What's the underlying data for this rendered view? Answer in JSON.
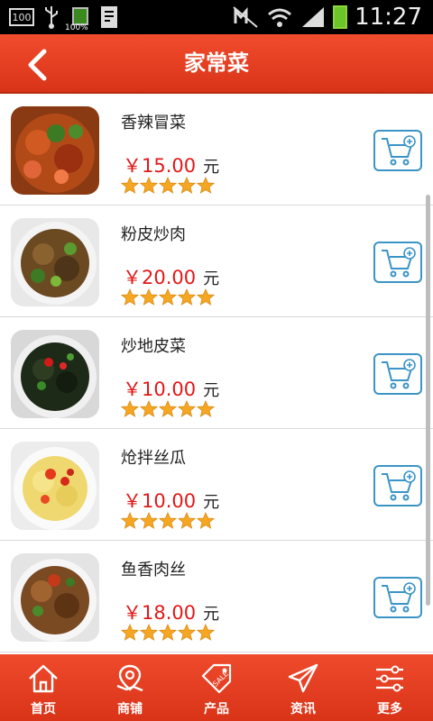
{
  "status_bar": {
    "badge": "100",
    "battery_pct": "100%",
    "time": "11:27"
  },
  "header": {
    "title": "家常菜",
    "back_icon": "chevron-left-icon"
  },
  "colors": {
    "header_red": "#e03c20",
    "price_red": "#e21818",
    "star_orange": "#f5a623",
    "cart_blue": "#3a94c6"
  },
  "items": [
    {
      "name": "香辣冒菜",
      "price": "￥15.00",
      "unit": "元",
      "rating": 5
    },
    {
      "name": "粉皮炒肉",
      "price": "￥20.00",
      "unit": "元",
      "rating": 5
    },
    {
      "name": "炒地皮菜",
      "price": "￥10.00",
      "unit": "元",
      "rating": 5
    },
    {
      "name": "炝拌丝瓜",
      "price": "￥10.00",
      "unit": "元",
      "rating": 5
    },
    {
      "name": "鱼香肉丝",
      "price": "￥18.00",
      "unit": "元",
      "rating": 5
    }
  ],
  "nav": [
    {
      "label": "首页",
      "icon": "home-icon"
    },
    {
      "label": "商铺",
      "icon": "map-pin-icon"
    },
    {
      "label": "产品",
      "icon": "sale-tag-icon"
    },
    {
      "label": "资讯",
      "icon": "paper-plane-icon"
    },
    {
      "label": "更多",
      "icon": "sliders-icon"
    }
  ]
}
